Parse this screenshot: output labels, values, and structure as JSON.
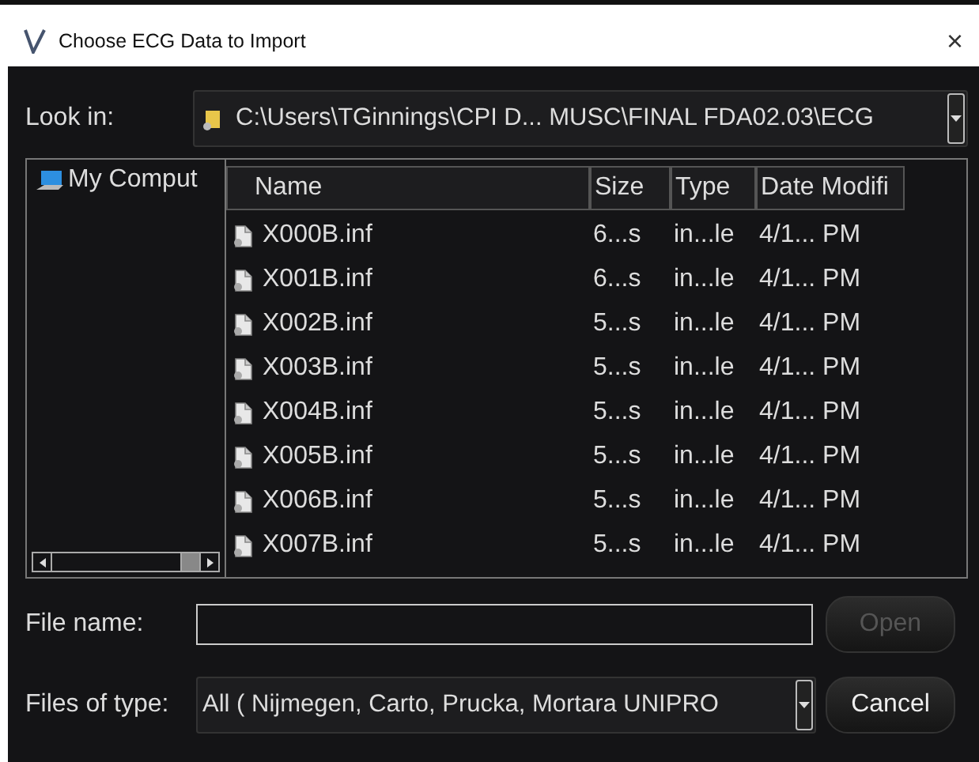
{
  "window": {
    "title": "Choose ECG Data to Import",
    "close": "×"
  },
  "look_in": {
    "label": "Look in:",
    "path": "C:\\Users\\TGinnings\\CPI D... MUSC\\FINAL FDA02.03\\ECG"
  },
  "tree": {
    "items": [
      {
        "label": "My Comput",
        "selected": false
      }
    ]
  },
  "table": {
    "columns": [
      "Name",
      "Size",
      "Type",
      "Date Modifi"
    ],
    "rows": [
      {
        "name": "X000B.inf",
        "size": "6...s",
        "type": "in...le",
        "date": "4/1... PM",
        "selected": false
      },
      {
        "name": "X001B.inf",
        "size": "6...s",
        "type": "in...le",
        "date": "4/1... PM",
        "selected": false
      },
      {
        "name": "X002B.inf",
        "size": "5...s",
        "type": "in...le",
        "date": "4/1... PM",
        "selected": false
      },
      {
        "name": "X003B.inf",
        "size": "5...s",
        "type": "in...le",
        "date": "4/1... PM",
        "selected": false
      },
      {
        "name": "X004B.inf",
        "size": "5...s",
        "type": "in...le",
        "date": "4/1... PM",
        "selected": false
      },
      {
        "name": "X005B.inf",
        "size": "5...s",
        "type": "in...le",
        "date": "4/1... PM",
        "selected": false
      },
      {
        "name": "X006B.inf",
        "size": "5...s",
        "type": "in...le",
        "date": "4/1... PM",
        "selected": false
      },
      {
        "name": "X007B.inf",
        "size": "5...s",
        "type": "in...le",
        "date": "4/1... PM",
        "selected": false
      }
    ]
  },
  "file_name": {
    "label": "File name:"
  },
  "files_of_type": {
    "label": "Files of type:",
    "value": "All ( Nijmegen, Carto, Prucka, Mortara UNIPRO"
  },
  "buttons": [
    {
      "label": "Open",
      "disabled": true
    },
    {
      "label": "Cancel",
      "disabled": false
    }
  ]
}
